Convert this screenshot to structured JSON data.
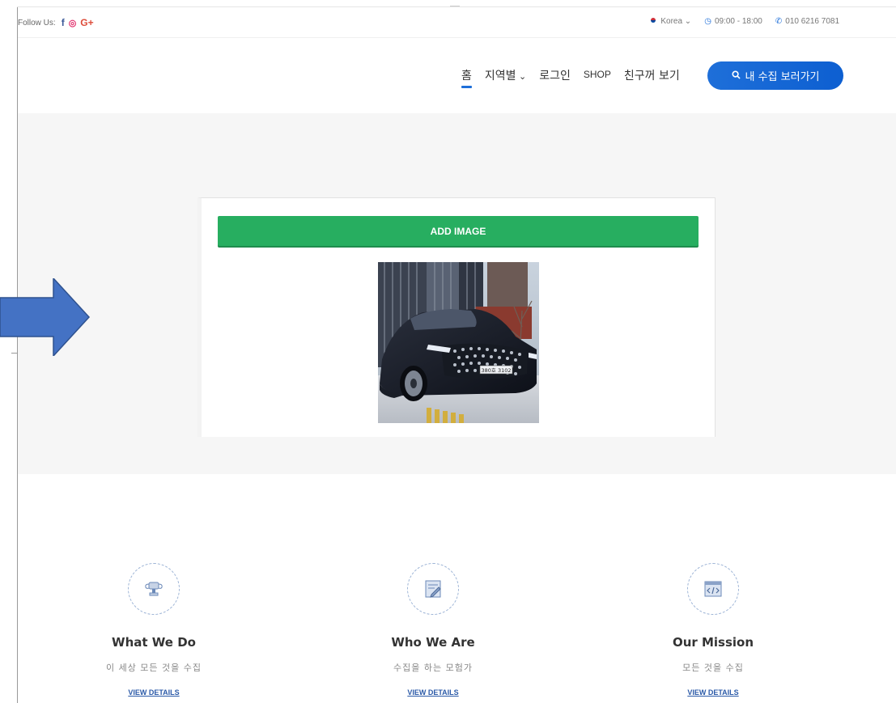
{
  "topbar": {
    "follow_label": "Follow Us:",
    "social_icons": [
      "facebook-icon",
      "instagram-icon",
      "google-plus-icon"
    ],
    "language": "Korea",
    "hours": "09:00 - 18:00",
    "phone": "010 6216 7081"
  },
  "nav": {
    "items": [
      {
        "label": "홈"
      },
      {
        "label": "지역별"
      },
      {
        "label": "로그인"
      },
      {
        "label": "SHOP"
      },
      {
        "label": "친구꺼 보기"
      }
    ],
    "cta_label": "내 수집 보러가기"
  },
  "hero": {
    "add_button_label": "ADD IMAGE",
    "plate_text": "380호 3102"
  },
  "features": [
    {
      "title": "What We Do",
      "desc": "이 세상 모든 것을 수집",
      "link": "VIEW DETAILS",
      "icon": "trophy-icon"
    },
    {
      "title": "Who We Are",
      "desc": "수집을 하는 모험가",
      "link": "VIEW DETAILS",
      "icon": "edit-document-icon"
    },
    {
      "title": "Our Mission",
      "desc": "모든 것을 수집",
      "link": "VIEW DETAILS",
      "icon": "code-window-icon"
    }
  ],
  "colors": {
    "accent_blue": "#1e6fd9",
    "add_green": "#27ae60",
    "arrow_blue": "#4472c4"
  }
}
